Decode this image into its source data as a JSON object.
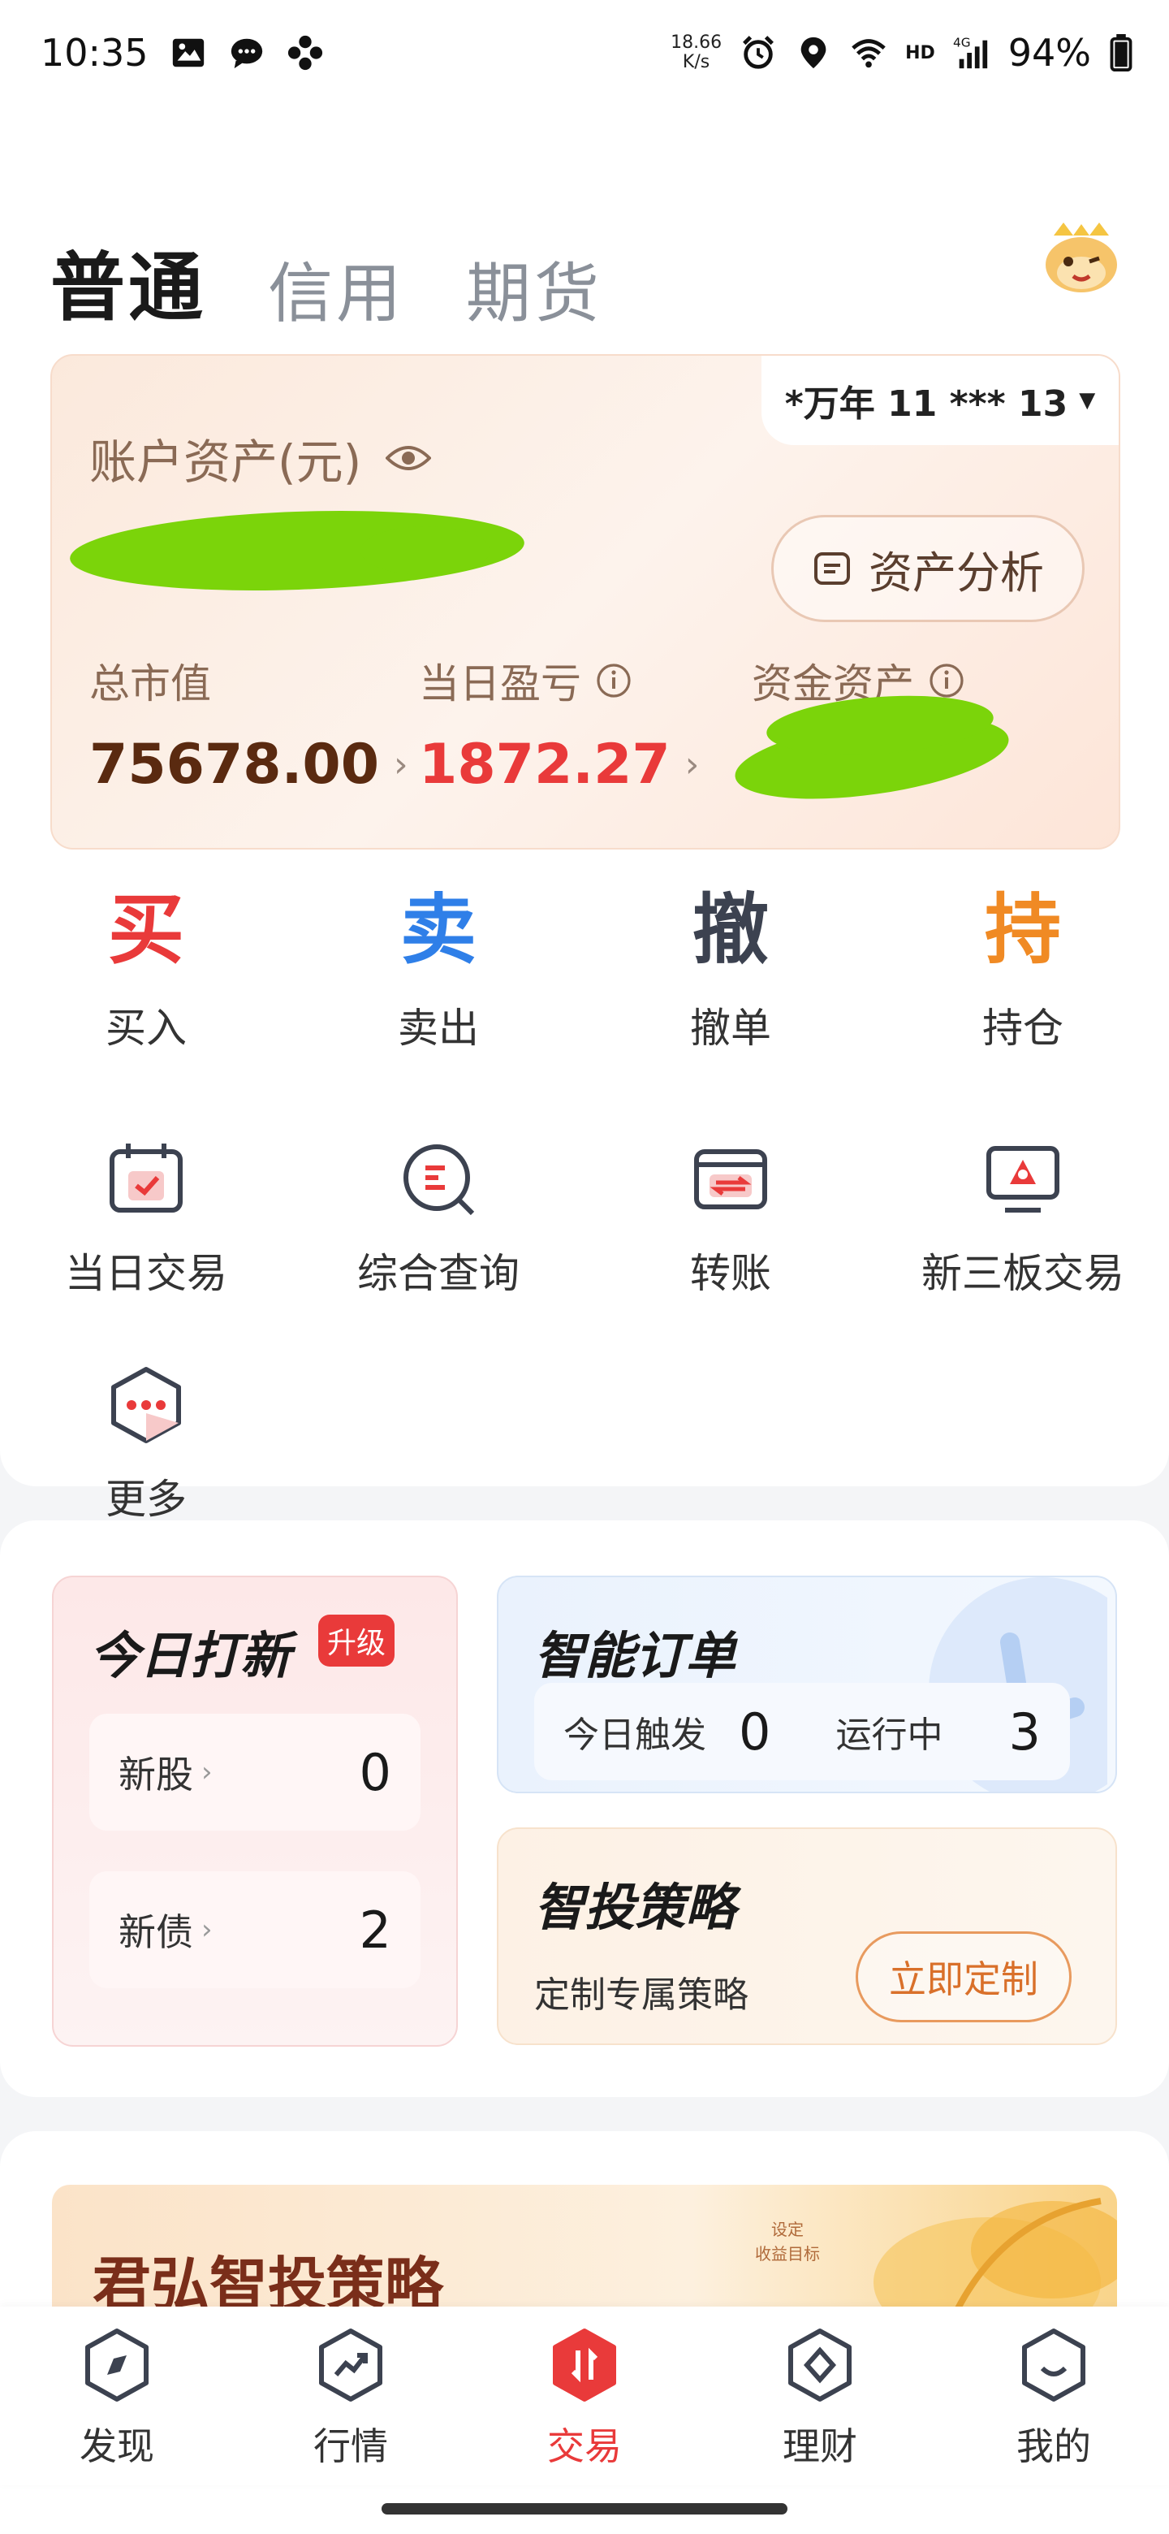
{
  "status_bar": {
    "time": "10:35",
    "net_speed_value": "18.66",
    "net_speed_unit": "K/s",
    "hd": "HD",
    "signal_label": "4G",
    "battery": "94%"
  },
  "tabs": [
    {
      "label": "普通",
      "active": true
    },
    {
      "label": "信用",
      "active": false
    },
    {
      "label": "期货",
      "active": false
    }
  ],
  "account": {
    "selector": "*万年 11 *** 13",
    "title": "账户资产(元)",
    "analysis_label": "资产分析",
    "metrics": [
      {
        "label": "总市值",
        "value": "75678.00",
        "color": "#5a2a10"
      },
      {
        "label": "当日盈亏",
        "value": "1872.27",
        "color": "#e93a3a"
      },
      {
        "label": "资金资产",
        "value": ""
      }
    ]
  },
  "trade_actions": [
    {
      "char": "买",
      "label": "买入",
      "color": "#e93a3a"
    },
    {
      "char": "卖",
      "label": "卖出",
      "color": "#2f7fe8"
    },
    {
      "char": "撤",
      "label": "撤单",
      "color": "#3c4250"
    },
    {
      "char": "持",
      "label": "持仓",
      "color": "#f08a24"
    }
  ],
  "functions": [
    {
      "label": "当日交易",
      "icon": "calendar-check-icon"
    },
    {
      "label": "综合查询",
      "icon": "search-query-icon"
    },
    {
      "label": "转账",
      "icon": "transfer-icon"
    },
    {
      "label": "新三板交易",
      "icon": "monitor-icon"
    },
    {
      "label": "更多",
      "icon": "more-hexagon-icon"
    }
  ],
  "ipo": {
    "title": "今日打新",
    "badge": "升级",
    "rows": [
      {
        "label": "新股",
        "count": "0"
      },
      {
        "label": "新债",
        "count": "2"
      }
    ]
  },
  "smart_order": {
    "title": "智能订单",
    "triggered_label": "今日触发",
    "triggered_count": "0",
    "running_label": "运行中",
    "running_count": "3"
  },
  "strategy": {
    "title": "智投策略",
    "subtitle": "定制专属策略",
    "button": "立即定制"
  },
  "banner": {
    "title": "君弘智投策略",
    "small_line1": "设定",
    "small_line2": "收益目标"
  },
  "bottom_tabs": [
    {
      "label": "发现",
      "icon": "compass-icon",
      "active": false
    },
    {
      "label": "行情",
      "icon": "trend-icon",
      "active": false
    },
    {
      "label": "交易",
      "icon": "trade-icon",
      "active": true
    },
    {
      "label": "理财",
      "icon": "wealth-icon",
      "active": false
    },
    {
      "label": "我的",
      "icon": "profile-icon",
      "active": false
    }
  ]
}
